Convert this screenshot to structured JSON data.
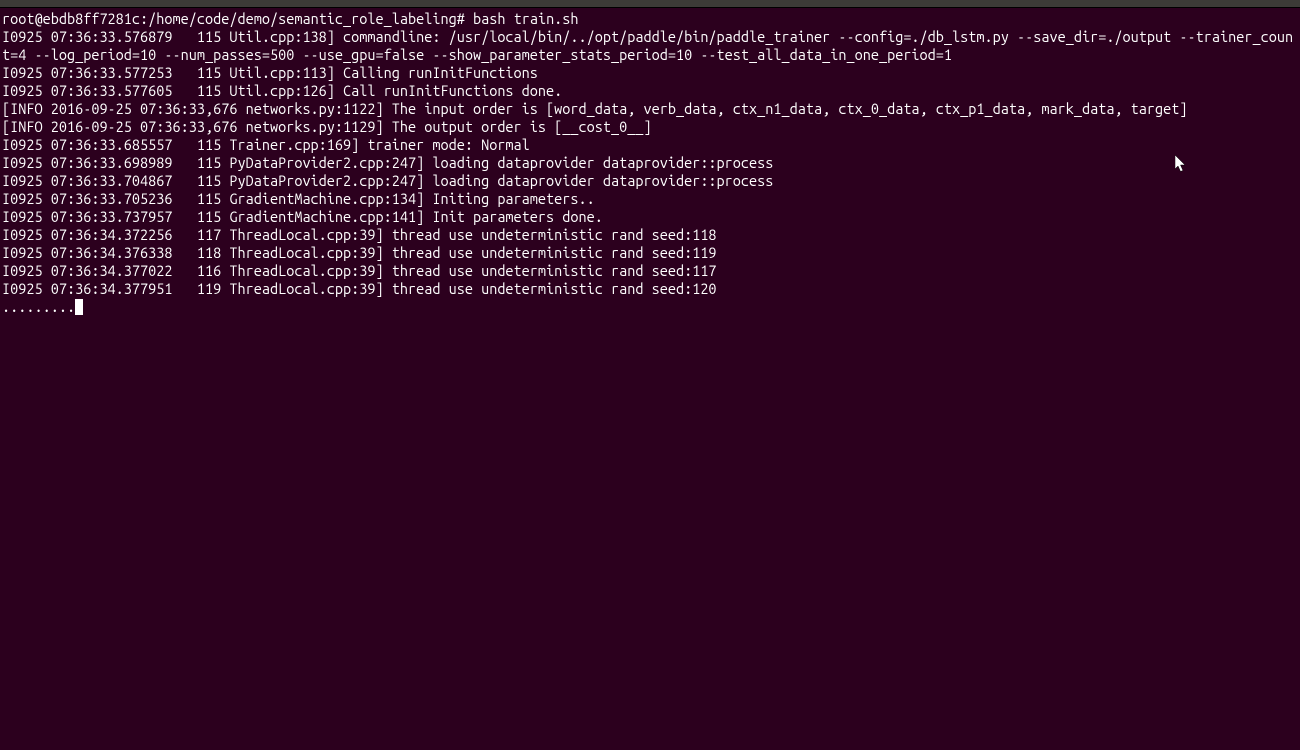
{
  "prompt": {
    "user_host": "root@ebdb8ff7281c",
    "path": "/home/code/demo/semantic_role_labeling",
    "separator": ":",
    "prompt_char": "#",
    "command": "bash train.sh"
  },
  "log_lines": [
    "I0925 07:36:33.576879   115 Util.cpp:138] commandline: /usr/local/bin/../opt/paddle/bin/paddle_trainer --config=./db_lstm.py --save_dir=./output --trainer_count=4 --log_period=10 --num_passes=500 --use_gpu=false --show_parameter_stats_period=10 --test_all_data_in_one_period=1",
    "I0925 07:36:33.577253   115 Util.cpp:113] Calling runInitFunctions",
    "I0925 07:36:33.577605   115 Util.cpp:126] Call runInitFunctions done.",
    "[INFO 2016-09-25 07:36:33,676 networks.py:1122] The input order is [word_data, verb_data, ctx_n1_data, ctx_0_data, ctx_p1_data, mark_data, target]",
    "[INFO 2016-09-25 07:36:33,676 networks.py:1129] The output order is [__cost_0__]",
    "I0925 07:36:33.685557   115 Trainer.cpp:169] trainer mode: Normal",
    "I0925 07:36:33.698989   115 PyDataProvider2.cpp:247] loading dataprovider dataprovider::process",
    "I0925 07:36:33.704867   115 PyDataProvider2.cpp:247] loading dataprovider dataprovider::process",
    "I0925 07:36:33.705236   115 GradientMachine.cpp:134] Initing parameters..",
    "I0925 07:36:33.737957   115 GradientMachine.cpp:141] Init parameters done.",
    "I0925 07:36:34.372256   117 ThreadLocal.cpp:39] thread use undeterministic rand seed:118",
    "I0925 07:36:34.376338   118 ThreadLocal.cpp:39] thread use undeterministic rand seed:119",
    "I0925 07:36:34.377022   116 ThreadLocal.cpp:39] thread use undeterministic rand seed:117",
    "I0925 07:36:34.377951   119 ThreadLocal.cpp:39] thread use undeterministic rand seed:120"
  ],
  "progress_dots": "........."
}
